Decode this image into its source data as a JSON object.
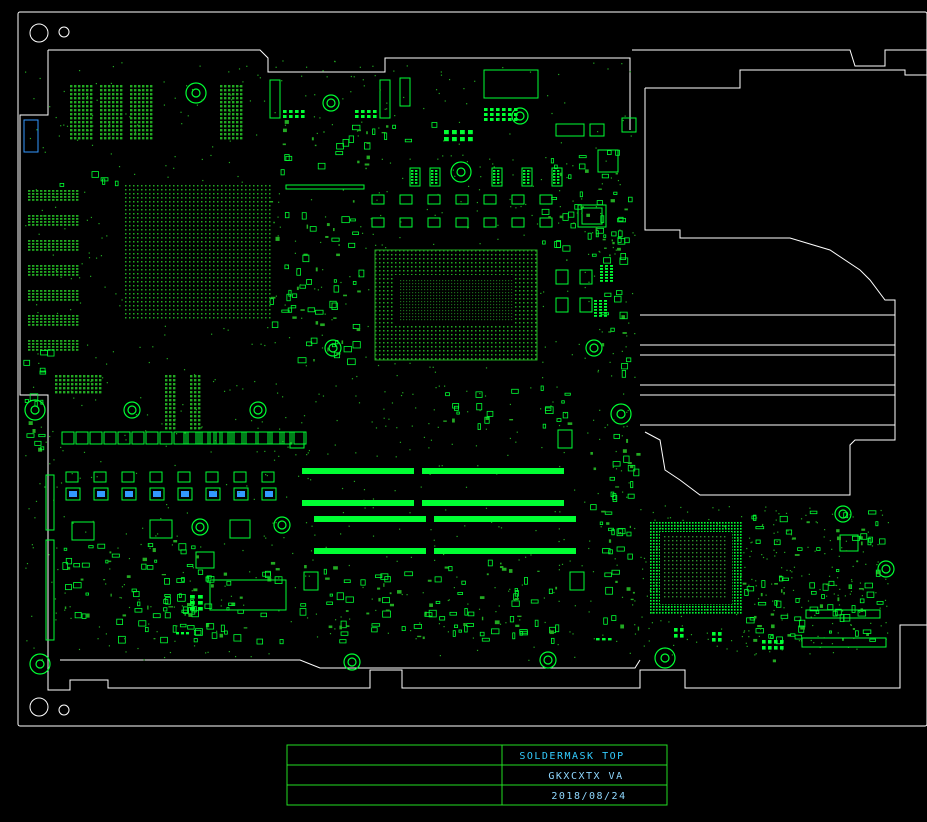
{
  "title_block": {
    "layer_name": "SOLDERMASK TOP",
    "board_id": "GKXCXTX VA",
    "date": "2018/08/24"
  },
  "colors": {
    "background": "#000000",
    "outline": "#ffffff",
    "copper": "#00ff33",
    "dim_copper": "#22aa22",
    "title_text": "#33ccff",
    "title_text_dim": "#8fd8ff",
    "title_border": "#22dd22"
  }
}
